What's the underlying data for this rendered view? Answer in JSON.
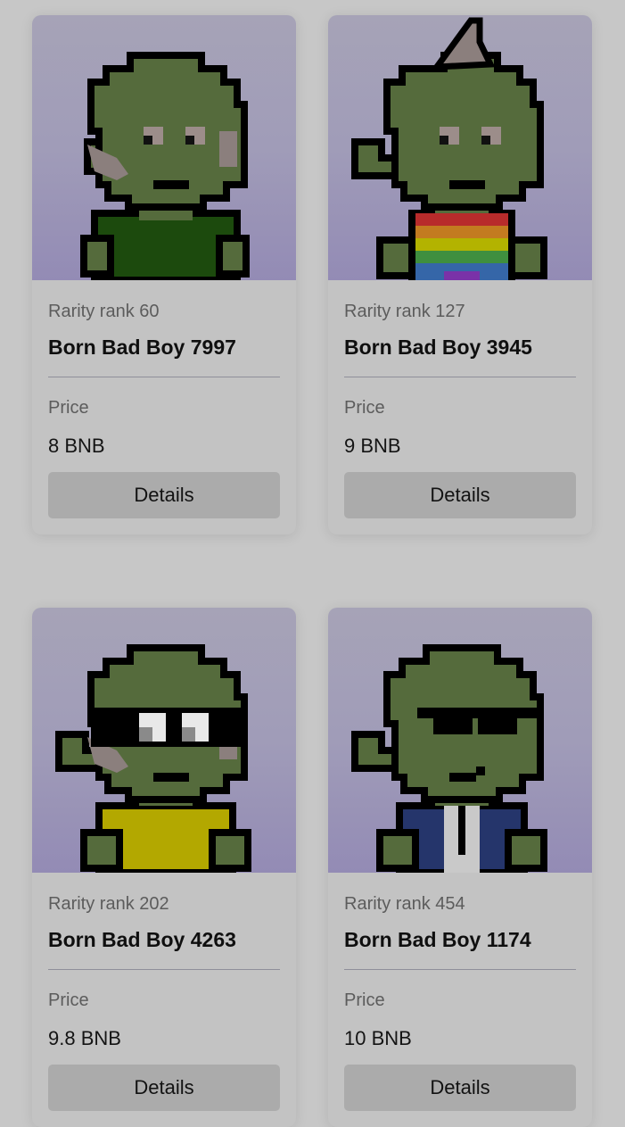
{
  "listings": [
    {
      "rarity": "Rarity rank 60",
      "name": "Born Bad Boy 7997",
      "price_label": "Price",
      "price": "8 BNB",
      "button": "Details",
      "avatar": {
        "shirt": "dark-green-tee",
        "accessory": "none",
        "extra": "scar"
      }
    },
    {
      "rarity": "Rarity rank 127",
      "name": "Born Bad Boy 3945",
      "price_label": "Price",
      "price": "9 BNB",
      "button": "Details",
      "avatar": {
        "shirt": "rainbow-tee",
        "accessory": "horn",
        "extra": "none"
      }
    },
    {
      "rarity": "Rarity rank 202",
      "name": "Born Bad Boy 4263",
      "price_label": "Price",
      "price": "9.8 BNB",
      "button": "Details",
      "avatar": {
        "shirt": "yellow-tee",
        "accessory": "goggles",
        "extra": "scar"
      }
    },
    {
      "rarity": "Rarity rank 454",
      "name": "Born Bad Boy 1174",
      "price_label": "Price",
      "price": "10 BNB",
      "button": "Details",
      "avatar": {
        "shirt": "blue-jacket",
        "accessory": "shades",
        "extra": "smirk"
      }
    }
  ],
  "colors": {
    "page_background": "#c7c7c7",
    "card_background": "#c3c3c3",
    "image_background_top": "#a6a3b7",
    "image_background_bottom": "#938bb5",
    "skin": "#556b3c",
    "outline": "#000000",
    "button_background": "#ababab"
  }
}
